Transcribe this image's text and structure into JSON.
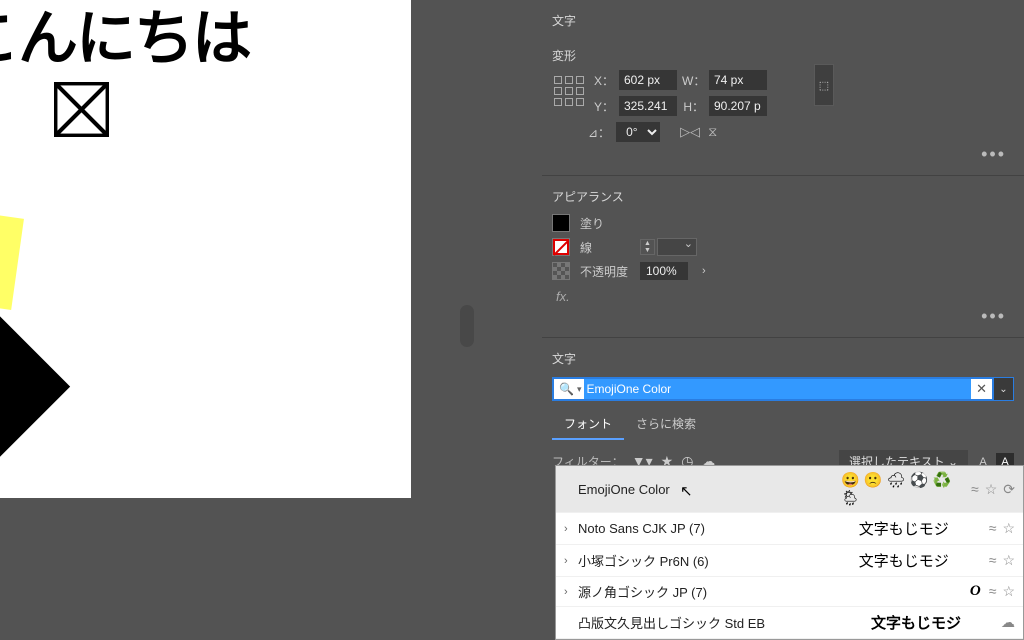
{
  "canvas": {
    "text": "こんにちは"
  },
  "panels": {
    "moji_header": "文字",
    "transform": {
      "title": "変形",
      "x_label": "X：",
      "x_value": "602 px",
      "w_label": "W：",
      "w_value": "74 px",
      "y_label": "Y：",
      "y_value": "325.241",
      "h_label": "H：",
      "h_value": "90.207 p",
      "angle_label": "⊿：",
      "angle_value": "0°"
    },
    "appearance": {
      "title": "アピアランス",
      "fill_label": "塗り",
      "stroke_label": "線",
      "opacity_label": "不透明度",
      "opacity_value": "100%",
      "fx_label": "fx."
    },
    "font": {
      "title": "文字",
      "search_value": "EmojiOne Color",
      "tab_font": "フォント",
      "tab_more": "さらに検索",
      "filter_label": "フィルター：",
      "selected_text": "選択したテキスト"
    }
  },
  "font_list": [
    {
      "name": "EmojiOne Color",
      "preview": "😀 🙁 🌧 ⚽ ♻️ 🌦",
      "expand": "",
      "hover": true,
      "emoji": true
    },
    {
      "name": "Noto Sans CJK JP (7)",
      "preview": "文字もじモジ",
      "expand": "›",
      "bold": false
    },
    {
      "name": "小塚ゴシック Pr6N (6)",
      "preview": "文字もじモジ",
      "expand": "›",
      "bold": false
    },
    {
      "name": "源ノ角ゴシック JP (7)",
      "preview": "文字もじモジ",
      "expand": "›",
      "bold": true,
      "ital": true,
      "serif_o": "O"
    },
    {
      "name": "凸版文久見出しゴシック Std EB",
      "preview": "文字もじモジ",
      "expand": "",
      "bold": true
    }
  ]
}
